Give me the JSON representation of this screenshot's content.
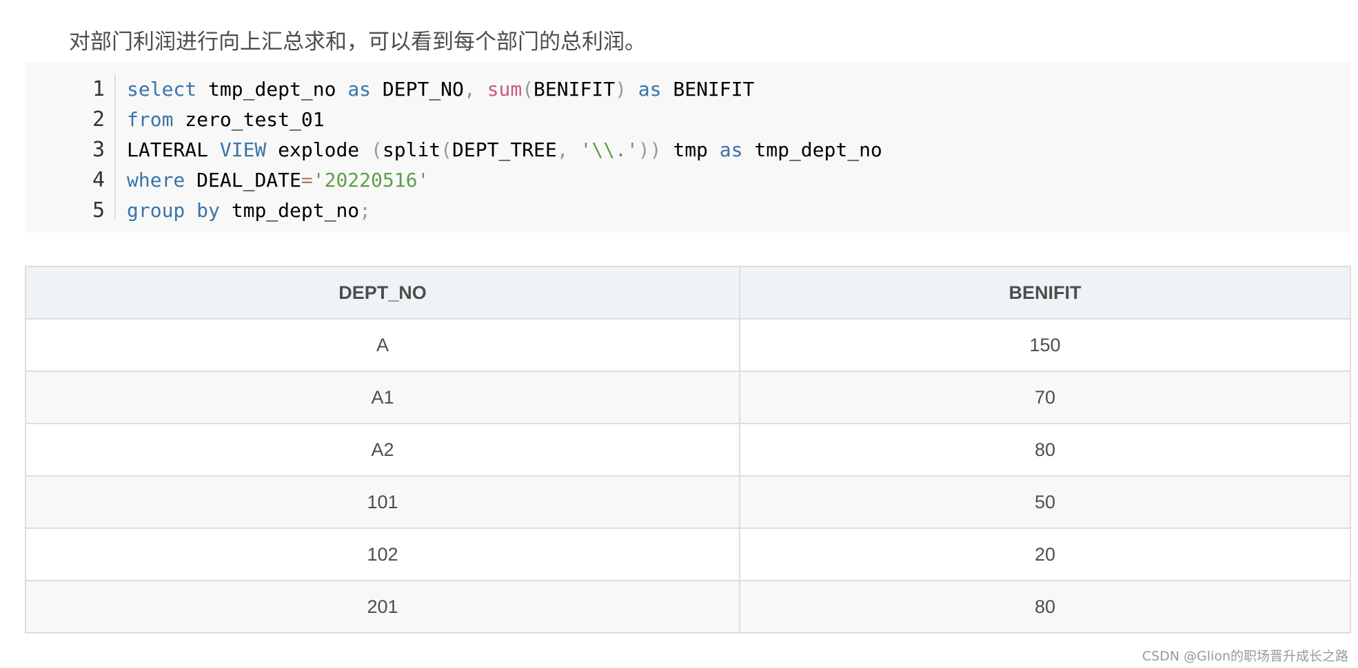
{
  "intro_text": "对部门利润进行向上汇总求和，可以看到每个部门的总利润。",
  "code": {
    "line_numbers": [
      "1",
      "2",
      "3",
      "4",
      "5"
    ],
    "lines": [
      [
        {
          "t": "select",
          "c": "kw"
        },
        {
          "t": " tmp_dept_no ",
          "c": ""
        },
        {
          "t": "as",
          "c": "kw"
        },
        {
          "t": " DEPT_NO",
          "c": ""
        },
        {
          "t": ",",
          "c": "punc"
        },
        {
          "t": " ",
          "c": ""
        },
        {
          "t": "sum",
          "c": "fn"
        },
        {
          "t": "(",
          "c": "punc"
        },
        {
          "t": "BENIFIT",
          "c": ""
        },
        {
          "t": ")",
          "c": "punc"
        },
        {
          "t": " ",
          "c": ""
        },
        {
          "t": "as",
          "c": "kw"
        },
        {
          "t": " BENIFIT",
          "c": ""
        }
      ],
      [
        {
          "t": "from",
          "c": "kw"
        },
        {
          "t": " zero_test_01",
          "c": ""
        }
      ],
      [
        {
          "t": "LATERAL ",
          "c": ""
        },
        {
          "t": "VIEW",
          "c": "kw"
        },
        {
          "t": " explode ",
          "c": ""
        },
        {
          "t": "(",
          "c": "punc"
        },
        {
          "t": "split",
          "c": ""
        },
        {
          "t": "(",
          "c": "punc"
        },
        {
          "t": "DEPT_TREE",
          "c": ""
        },
        {
          "t": ",",
          "c": "punc"
        },
        {
          "t": " ",
          "c": ""
        },
        {
          "t": "'\\\\.'",
          "c": "str"
        },
        {
          "t": "))",
          "c": "punc"
        },
        {
          "t": " tmp ",
          "c": ""
        },
        {
          "t": "as",
          "c": "kw"
        },
        {
          "t": " tmp_dept_no",
          "c": ""
        }
      ],
      [
        {
          "t": "where",
          "c": "kw"
        },
        {
          "t": " DEAL_DATE",
          "c": ""
        },
        {
          "t": "=",
          "c": "op"
        },
        {
          "t": "'20220516'",
          "c": "str"
        }
      ],
      [
        {
          "t": "group",
          "c": "kw"
        },
        {
          "t": " ",
          "c": ""
        },
        {
          "t": "by",
          "c": "kw"
        },
        {
          "t": " tmp_dept_no",
          "c": ""
        },
        {
          "t": ";",
          "c": "punc"
        }
      ]
    ]
  },
  "table": {
    "headers": [
      "DEPT_NO",
      "BENIFIT"
    ],
    "rows": [
      [
        "A",
        "150"
      ],
      [
        "A1",
        "70"
      ],
      [
        "A2",
        "80"
      ],
      [
        "101",
        "50"
      ],
      [
        "102",
        "20"
      ],
      [
        "201",
        "80"
      ]
    ]
  },
  "watermark": "CSDN @Glion的职场晋升成长之路",
  "colors": {
    "keyword": "#3a73a8",
    "function": "#c75a7a",
    "string": "#5c9e4a",
    "punctuation": "#999999",
    "code_bg": "#f8f8f8",
    "header_bg": "#eff3f5"
  }
}
